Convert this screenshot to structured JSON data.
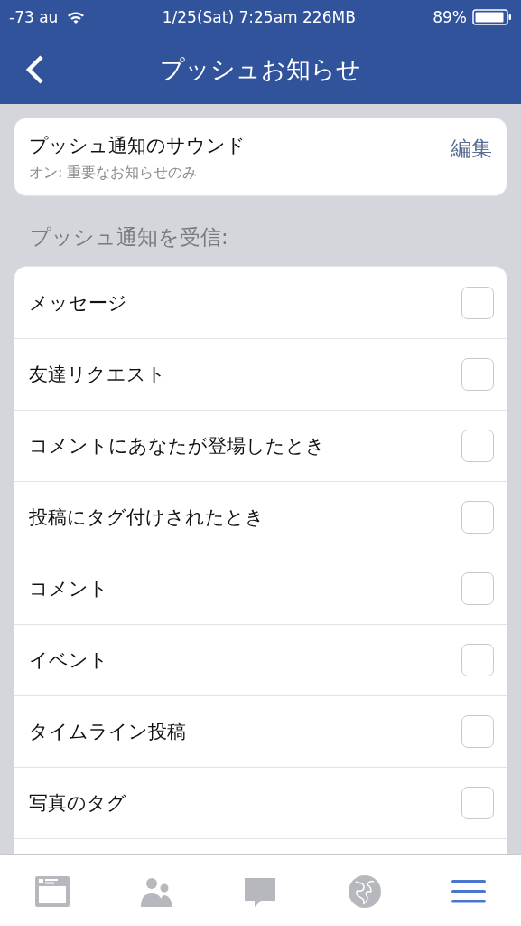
{
  "status_bar": {
    "carrier": "-73 au",
    "center": "1/25(Sat) 7:25am 226MB",
    "battery": "89%"
  },
  "nav": {
    "title": "プッシュお知らせ"
  },
  "sound": {
    "title": "プッシュ通知のサウンド",
    "subtitle": "オン: 重要なお知らせのみ",
    "action": "編集"
  },
  "section_header": "プッシュ通知を受信:",
  "items": [
    {
      "label": "メッセージ",
      "checked": false
    },
    {
      "label": "友達リクエスト",
      "checked": false
    },
    {
      "label": "コメントにあなたが登場したとき",
      "checked": false
    },
    {
      "label": "投稿にタグ付けされたとき",
      "checked": false
    },
    {
      "label": "コメント",
      "checked": false
    },
    {
      "label": "イベント",
      "checked": false
    },
    {
      "label": "タイムライン投稿",
      "checked": false
    },
    {
      "label": "写真のタグ",
      "checked": false
    }
  ],
  "tab_bar": [
    {
      "kind": "feed",
      "selected": false
    },
    {
      "kind": "friends",
      "selected": false
    },
    {
      "kind": "messages",
      "selected": false
    },
    {
      "kind": "notifications",
      "selected": false
    },
    {
      "kind": "more",
      "selected": true
    }
  ]
}
